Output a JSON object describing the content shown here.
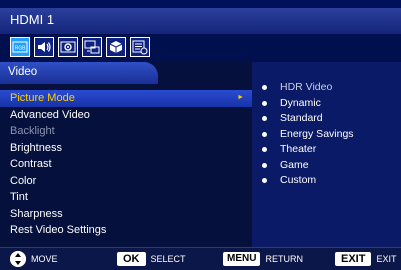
{
  "header": {
    "title": "HDMI 1"
  },
  "icon_tabs": [
    {
      "name": "picture-settings-icon",
      "label": "RGB",
      "active": true
    },
    {
      "name": "audio-speaker-icon"
    },
    {
      "name": "settings-gear-icon"
    },
    {
      "name": "network-icon"
    },
    {
      "name": "channel-cube-icon"
    },
    {
      "name": "schedule-clock-icon"
    }
  ],
  "section": {
    "title": "Video"
  },
  "menu": {
    "items": [
      {
        "label": "Picture Mode",
        "state": "selected"
      },
      {
        "label": "Advanced Video",
        "state": "normal"
      },
      {
        "label": "Backlight",
        "state": "disabled"
      },
      {
        "label": "Brightness",
        "state": "normal"
      },
      {
        "label": "Contrast",
        "state": "normal"
      },
      {
        "label": "Color",
        "state": "normal"
      },
      {
        "label": "Tint",
        "state": "normal"
      },
      {
        "label": "Sharpness",
        "state": "normal"
      },
      {
        "label": "Rest Video Settings",
        "state": "normal"
      }
    ]
  },
  "options": {
    "items": [
      {
        "label": "HDR Video",
        "state": "disabled"
      },
      {
        "label": "Dynamic"
      },
      {
        "label": "Standard"
      },
      {
        "label": "Energy Savings"
      },
      {
        "label": "Theater"
      },
      {
        "label": "Game"
      },
      {
        "label": "Custom"
      }
    ]
  },
  "footer": {
    "move_label": "MOVE",
    "ok_key": "OK",
    "select_label": "SELECT",
    "menu_key": "MENU",
    "return_label": "RETURN",
    "exit_key": "EXIT",
    "exit_label": "EXIT"
  },
  "colors": {
    "selection_text": "#ffd100",
    "highlight": "#2a4bd0",
    "panel": "#05103c",
    "option_panel": "#0a1a66",
    "header": "#2a3f9c"
  }
}
